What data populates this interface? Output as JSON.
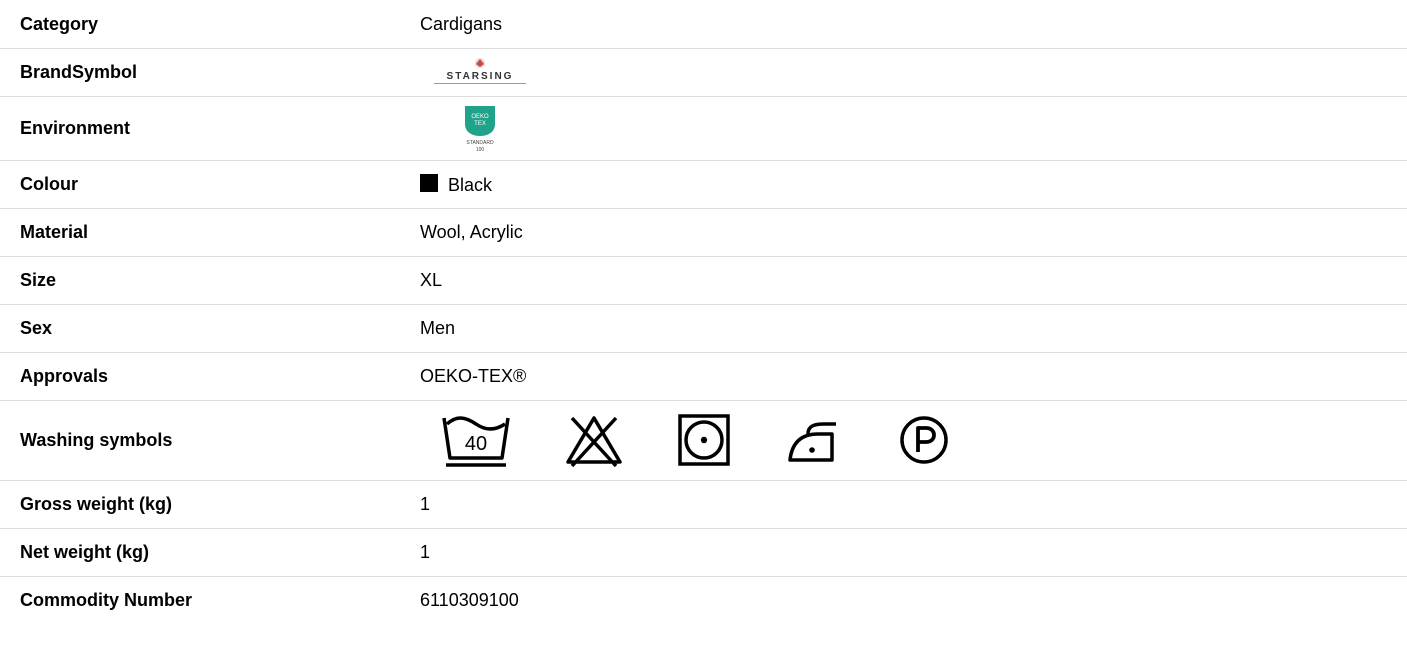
{
  "specs": {
    "category": {
      "label": "Category",
      "value": "Cardigans"
    },
    "brand_symbol": {
      "label": "BrandSymbol",
      "logo_text": "STARSING",
      "logo_icon": "brand-logo-icon"
    },
    "environment": {
      "label": "Environment",
      "badge_text": "OEKO TEX",
      "caption": "STANDARD 100",
      "badge_color": "#1fa38a"
    },
    "colour": {
      "label": "Colour",
      "value": "Black",
      "swatch_color": "#000000"
    },
    "material": {
      "label": "Material",
      "value": "Wool, Acrylic"
    },
    "size": {
      "label": "Size",
      "value": "XL"
    },
    "sex": {
      "label": "Sex",
      "value": "Men"
    },
    "approvals": {
      "label": "Approvals",
      "value": "OEKO-TEX®"
    },
    "washing_symbols": {
      "label": "Washing symbols",
      "wash_temp": "40",
      "icons": [
        "wash-40-icon",
        "do-not-bleach-icon",
        "tumble-dry-low-icon",
        "iron-low-icon",
        "dry-clean-p-icon"
      ]
    },
    "gross_weight": {
      "label": "Gross weight (kg)",
      "value": "1"
    },
    "net_weight": {
      "label": "Net weight (kg)",
      "value": "1"
    },
    "commodity_number": {
      "label": "Commodity Number",
      "value": "6110309100"
    }
  },
  "colors": {
    "border": "#dddddd",
    "text": "#000000"
  }
}
